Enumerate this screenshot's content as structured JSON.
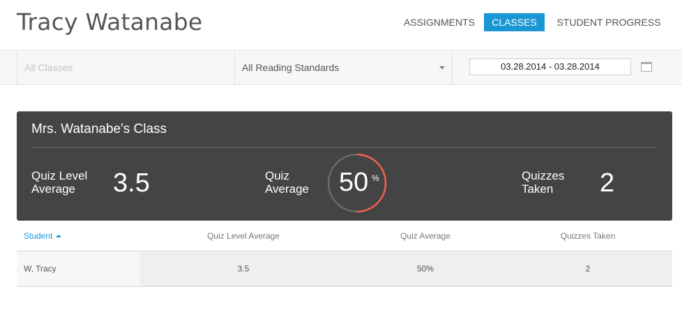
{
  "header": {
    "title": "Tracy Watanabe",
    "nav": [
      {
        "label": "ASSIGNMENTS",
        "active": false
      },
      {
        "label": "CLASSES",
        "active": true
      },
      {
        "label": "STUDENT PROGRESS",
        "active": false
      }
    ]
  },
  "filters": {
    "classes_placeholder": "All Classes",
    "standards_value": "All Reading Standards",
    "date_range": "03.28.2014 - 03.28.2014"
  },
  "class_panel": {
    "title": "Mrs. Watanabe's Class",
    "quiz_level_label_1": "Quiz Level",
    "quiz_level_label_2": "Average",
    "quiz_level_value": "3.5",
    "quiz_average_label_1": "Quiz",
    "quiz_average_label_2": "Average",
    "quiz_average_value": "50",
    "quiz_average_unit": "%",
    "quiz_average_fraction": 0.5,
    "quizzes_taken_label_1": "Quizzes",
    "quizzes_taken_label_2": "Taken",
    "quizzes_taken_value": "2",
    "ring_color": "#f0614b",
    "ring_track_color": "#6a6a6a"
  },
  "table": {
    "headers": [
      "Student",
      "Quiz Level Average",
      "Quiz Average",
      "Quizzes Taken"
    ],
    "rows": [
      {
        "student": "W, Tracy",
        "quiz_level_average": "3.5",
        "quiz_average": "50%",
        "quizzes_taken": "2"
      }
    ]
  },
  "colors": {
    "accent": "#1a96d4",
    "panel_bg": "#444444"
  }
}
